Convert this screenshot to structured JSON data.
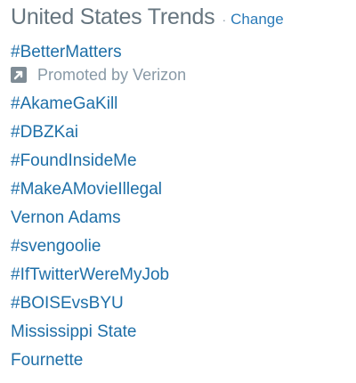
{
  "module": {
    "title": "United States Trends",
    "separator": "·",
    "change_label": "Change"
  },
  "promoted_trend": {
    "label": "#BetterMatters",
    "promoted_text": "Promoted by Verizon",
    "icon": "promoted-arrow-icon"
  },
  "trends": [
    "#AkameGaKill",
    "#DBZKai",
    "#FoundInsideMe",
    "#MakeAMovieIllegal",
    "Vernon Adams",
    "#svengoolie",
    "#IfTwitterWereMyJob",
    "#BOISEvsBYU",
    "Mississippi State",
    "Fournette"
  ],
  "colors": {
    "title": "#66757f",
    "link": "#1e6fa8",
    "change_link": "#2b7bb9",
    "promoted_text": "#8899a6",
    "promoted_icon_bg": "#7f8c96"
  }
}
